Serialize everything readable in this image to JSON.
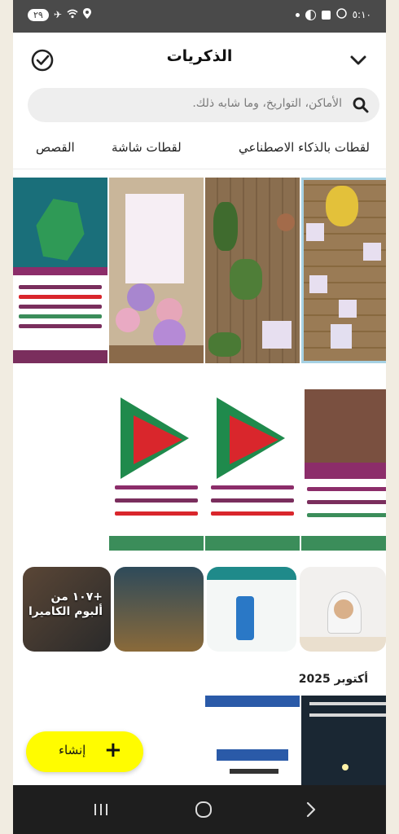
{
  "status_bar": {
    "badge": "٢٩",
    "time": "٥:١٠"
  },
  "header": {
    "title": "الذكريات"
  },
  "search": {
    "placeholder": "الأماكن، التواريخ، وما شابه ذلك."
  },
  "tabs": [
    {
      "label": "لقطات بالذكاء الاصطناعي"
    },
    {
      "label": "لقطات شاشة"
    },
    {
      "label": "القصص"
    }
  ],
  "stories": [
    {
      "label": "+١٠٧ من ألبوم الكاميرا"
    }
  ],
  "section": {
    "title": "أكتوبر 2025"
  },
  "fab": {
    "label": "إنشاء"
  },
  "colors": {
    "accent_yellow": "#fffc00",
    "poster_green": "#1f8a4c",
    "poster_magenta": "#8c2d6a",
    "poster_red": "#d9262c"
  }
}
